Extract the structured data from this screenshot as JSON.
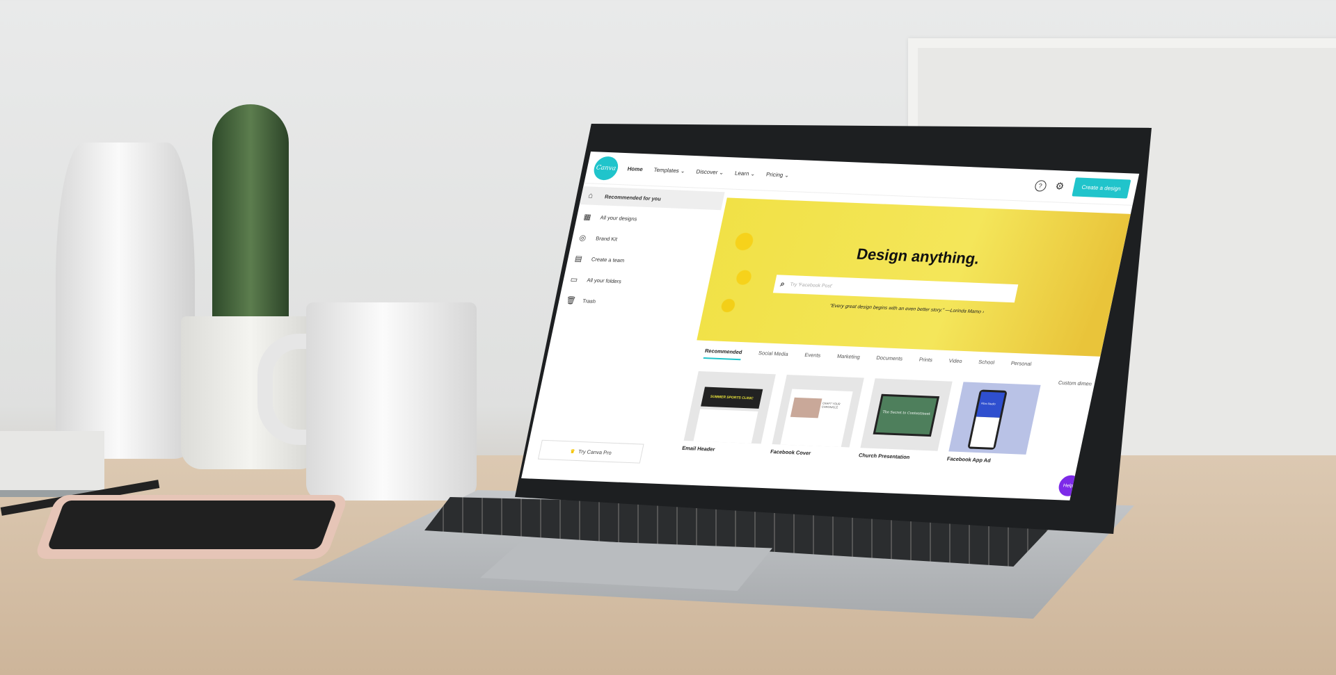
{
  "header": {
    "logo": "Canva",
    "nav": [
      "Home",
      "Templates",
      "Discover",
      "Learn",
      "Pricing"
    ],
    "help_icon": "?",
    "settings_icon": "⚙",
    "create_button": "Create a design"
  },
  "sidebar": {
    "items": [
      {
        "label": "Recommended for you",
        "icon": "⌂"
      },
      {
        "label": "All your designs",
        "icon": "▦"
      },
      {
        "label": "Brand Kit",
        "icon": "◎"
      },
      {
        "label": "Create a team",
        "icon": "▤"
      },
      {
        "label": "All your folders",
        "icon": "▭"
      },
      {
        "label": "Trash",
        "icon": "🗑"
      }
    ],
    "try_pro": "Try Canva Pro"
  },
  "hero": {
    "title": "Design anything.",
    "search_placeholder": "Try 'Facebook Post'",
    "quote": "\"Every great design begins with an even better story.\" —Lorinda Mamo ›"
  },
  "tabs": [
    "Recommended",
    "Social Media",
    "Events",
    "Marketing",
    "Documents",
    "Prints",
    "Video",
    "School",
    "Personal"
  ],
  "custom_dimensions": "Custom dimen",
  "cards": [
    {
      "label": "Email Header",
      "thumb_text": "SUMMER SPORTS CLINIC"
    },
    {
      "label": "Facebook Cover",
      "thumb_text": "CRAFT YOUR CHRONICLE"
    },
    {
      "label": "Church Presentation",
      "thumb_text": "The Secret to Contentment"
    },
    {
      "label": "Facebook App Ad",
      "thumb_text": "Flow Studio"
    }
  ],
  "help_button": "Help",
  "colors": {
    "accent": "#20c4cb",
    "hero": "#f1e146",
    "help": "#7d2ae8"
  }
}
